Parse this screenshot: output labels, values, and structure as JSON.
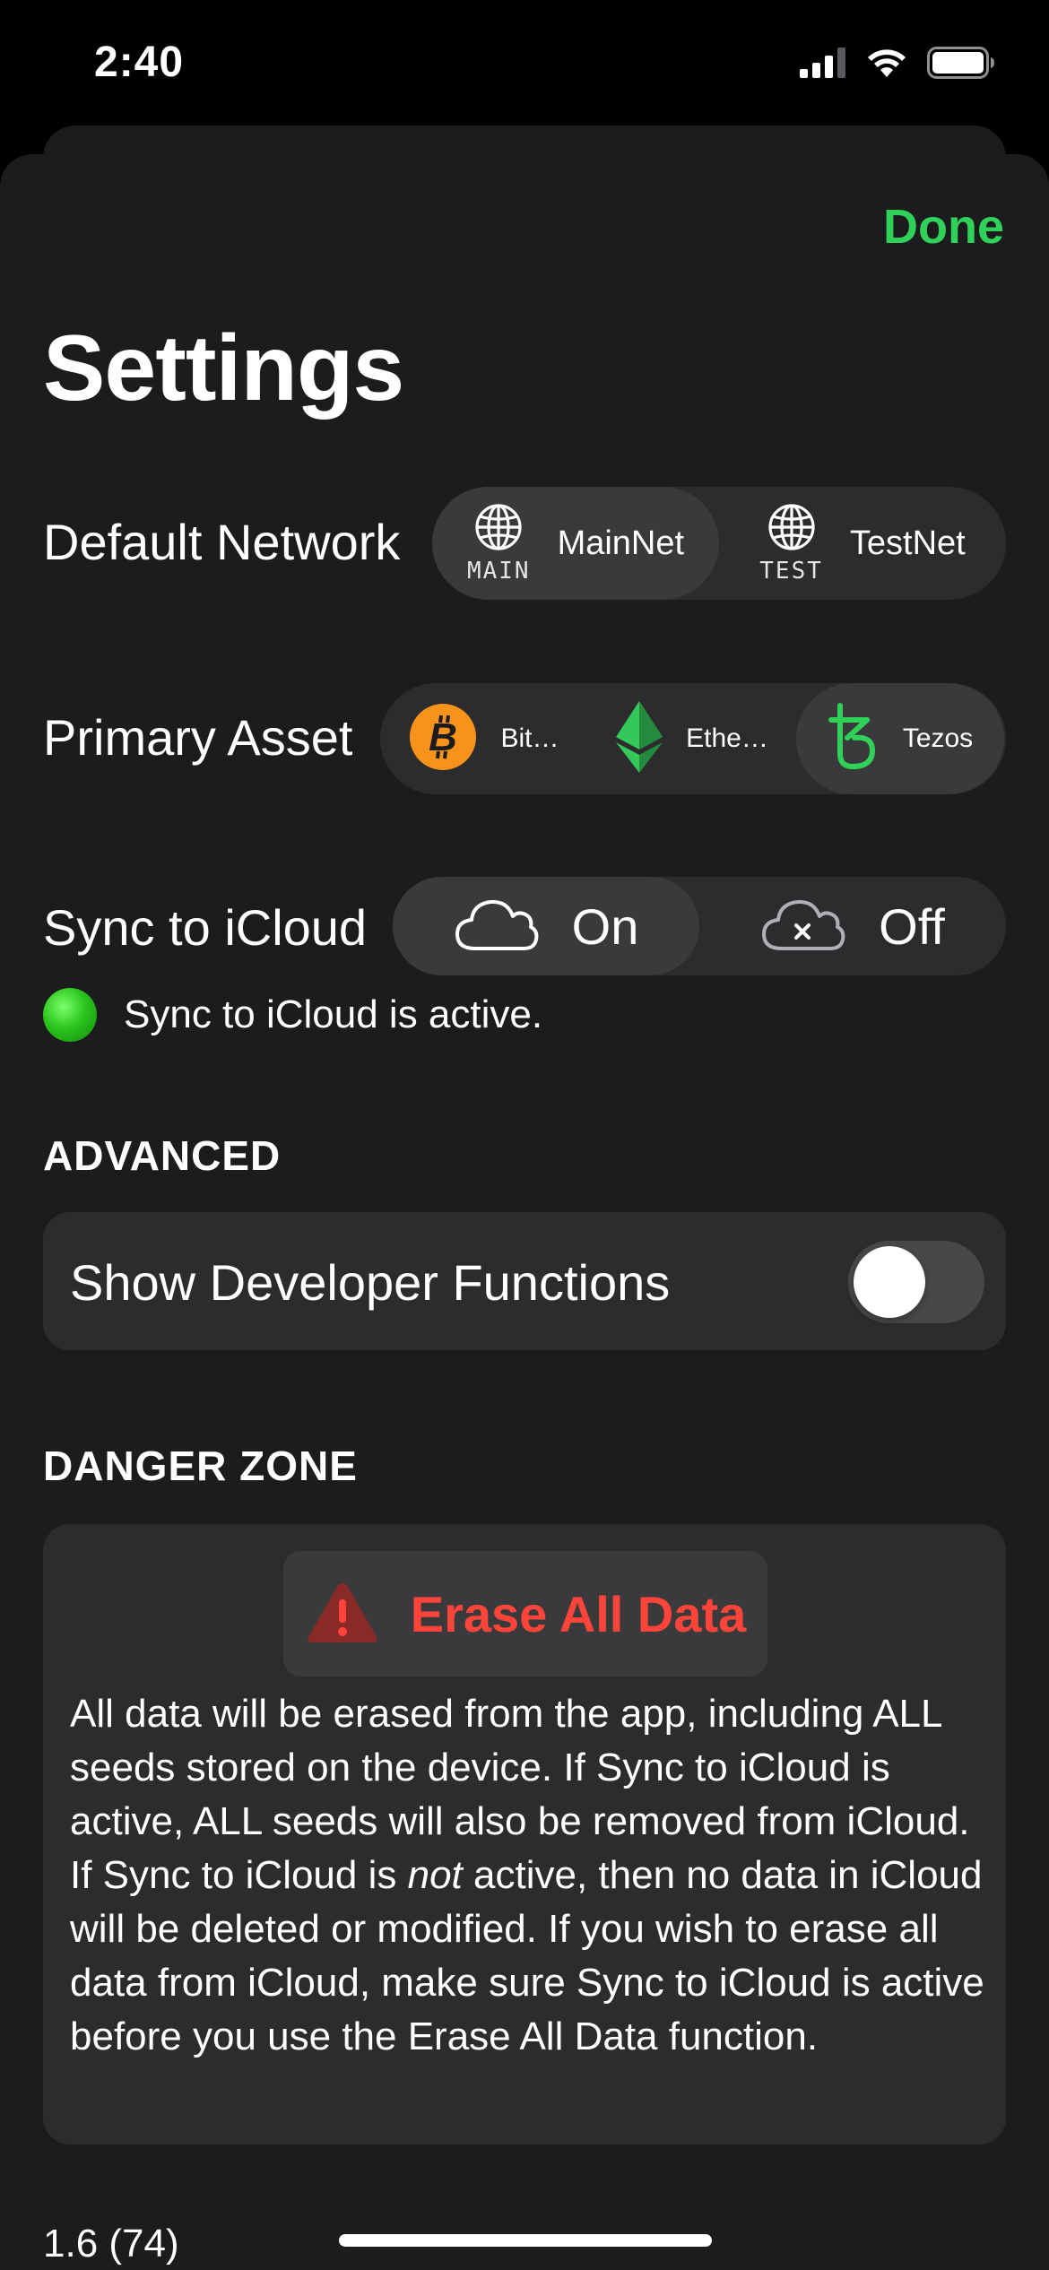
{
  "status_bar": {
    "time": "2:40"
  },
  "header": {
    "done_label": "Done",
    "title": "Settings"
  },
  "default_network": {
    "label": "Default Network",
    "options": [
      {
        "icon": "globe-icon",
        "icon_label": "MAIN",
        "label": "MainNet",
        "selected": true
      },
      {
        "icon": "globe-icon",
        "icon_label": "TEST",
        "label": "TestNet",
        "selected": false
      }
    ]
  },
  "primary_asset": {
    "label": "Primary Asset",
    "options": [
      {
        "icon": "bitcoin-icon",
        "label": "Bit…",
        "selected": false
      },
      {
        "icon": "ethereum-icon",
        "label": "Ethe…",
        "selected": false
      },
      {
        "icon": "tezos-icon",
        "label": "Tezos",
        "selected": true
      }
    ]
  },
  "sync_icloud": {
    "label": "Sync to iCloud",
    "options": [
      {
        "icon": "cloud-icon",
        "label": "On",
        "selected": true
      },
      {
        "icon": "cloud-x-icon",
        "label": "Off",
        "selected": false
      }
    ],
    "status_text": "Sync to iCloud is active."
  },
  "advanced": {
    "header": "ADVANCED",
    "developer_label": "Show Developer Functions",
    "developer_enabled": false
  },
  "danger_zone": {
    "header": "DANGER ZONE",
    "erase_label": "Erase All Data",
    "description_part1": "All data will be erased from the app, including ALL seeds stored on the device. If Sync to iCloud is active, ALL seeds will also be removed from iCloud. If Sync to iCloud is ",
    "description_emphasis": "not",
    "description_part2": " active, then no data in iCloud will be deleted or modified. If you wish to erase all data from iCloud, make sure Sync to iCloud is active before you use the Erase All Data function."
  },
  "version": "1.6 (74)",
  "colors": {
    "accent": "#30d158",
    "danger": "#ff453a",
    "bitcoin": "#f7931a",
    "ethereum": "#34c759",
    "tezos": "#30d158",
    "background": "#1c1c1e",
    "card": "#2c2c2e"
  }
}
